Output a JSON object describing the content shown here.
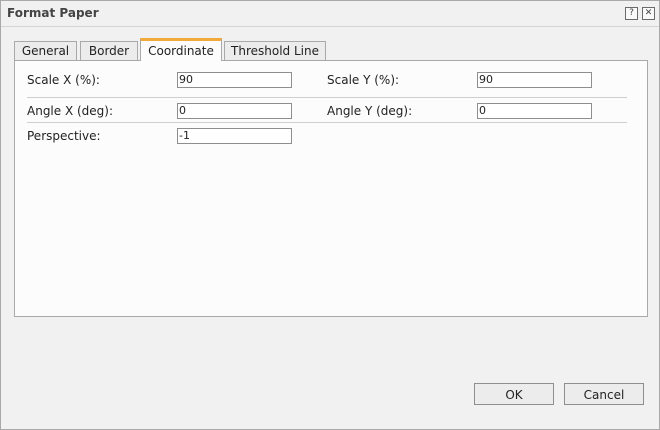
{
  "dialog": {
    "title": "Format Paper",
    "help_icon": "question-mark-icon",
    "close_icon": "close-icon"
  },
  "tabs": [
    {
      "label": "General",
      "active": false
    },
    {
      "label": "Border",
      "active": false
    },
    {
      "label": "Coordinate",
      "active": true
    },
    {
      "label": "Threshold Line",
      "active": false
    }
  ],
  "form": {
    "scale_x_label": "Scale X (%):",
    "scale_x_value": "90",
    "scale_y_label": "Scale Y (%):",
    "scale_y_value": "90",
    "angle_x_label": "Angle X (deg):",
    "angle_x_value": "0",
    "angle_y_label": "Angle Y (deg):",
    "angle_y_value": "0",
    "perspective_label": "Perspective:",
    "perspective_value": "-1"
  },
  "buttons": {
    "ok": "OK",
    "cancel": "Cancel"
  },
  "colors": {
    "active_tab_accent": "#f2a93b",
    "background": "#f1f1f1",
    "panel": "#fcfcfc"
  }
}
